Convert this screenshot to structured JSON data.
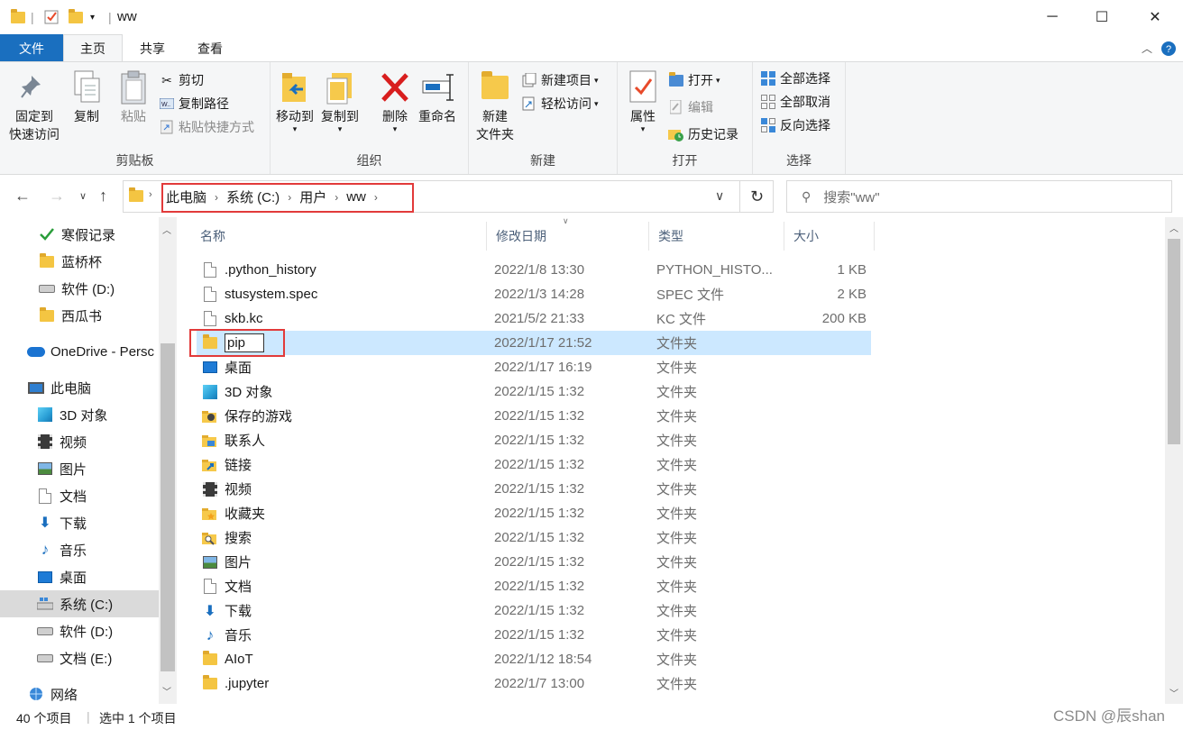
{
  "window": {
    "title": "ww",
    "controls": {
      "minimize": "─",
      "maximize": "☐",
      "close": "✕"
    }
  },
  "ribbon_tabs": [
    "文件",
    "主页",
    "共享",
    "查看"
  ],
  "ribbon": {
    "clipboard": {
      "label": "剪贴板",
      "pin_line1": "固定到",
      "pin_line2": "快速访问",
      "copy": "复制",
      "paste": "粘贴",
      "cut": "剪切",
      "copy_path": "复制路径",
      "paste_shortcut": "粘贴快捷方式"
    },
    "organize": {
      "label": "组织",
      "move_to": "移动到",
      "copy_to": "复制到",
      "delete": "删除",
      "rename": "重命名"
    },
    "new": {
      "label": "新建",
      "new_folder_line1": "新建",
      "new_folder_line2": "文件夹",
      "new_item": "新建项目",
      "easy_access": "轻松访问"
    },
    "open": {
      "label": "打开",
      "properties": "属性",
      "open": "打开",
      "edit": "编辑",
      "history": "历史记录"
    },
    "select": {
      "label": "选择",
      "select_all": "全部选择",
      "select_none": "全部取消",
      "invert": "反向选择"
    }
  },
  "address": {
    "crumbs": [
      "此电脑",
      "系统 (C:)",
      "用户",
      "ww"
    ],
    "search_placeholder": "搜索\"ww\""
  },
  "sidebar": {
    "items": [
      {
        "label": "寒假记录",
        "icon": "pin-check-icon"
      },
      {
        "label": "蓝桥杯",
        "icon": "folder-icon"
      },
      {
        "label": "软件 (D:)",
        "icon": "drive-icon"
      },
      {
        "label": "西瓜书",
        "icon": "folder-icon"
      },
      {
        "label": "OneDrive - Persc",
        "icon": "cloud-icon"
      },
      {
        "label": "此电脑",
        "icon": "computer-icon"
      },
      {
        "label": "3D 对象",
        "icon": "cube-icon"
      },
      {
        "label": "视频",
        "icon": "film-icon"
      },
      {
        "label": "图片",
        "icon": "picture-icon"
      },
      {
        "label": "文档",
        "icon": "document-icon"
      },
      {
        "label": "下载",
        "icon": "download-icon"
      },
      {
        "label": "音乐",
        "icon": "music-icon"
      },
      {
        "label": "桌面",
        "icon": "desktop-icon"
      },
      {
        "label": "系统 (C:)",
        "icon": "windows-drive-icon"
      },
      {
        "label": "软件 (D:)",
        "icon": "drive-icon"
      },
      {
        "label": "文档 (E:)",
        "icon": "drive-icon"
      },
      {
        "label": "网络",
        "icon": "network-icon"
      }
    ]
  },
  "columns": {
    "name": "名称",
    "date": "修改日期",
    "type": "类型",
    "size": "大小"
  },
  "files": [
    {
      "name": ".python_history",
      "date": "2022/1/8 13:30",
      "type": "PYTHON_HISTO...",
      "size": "1 KB",
      "icon": "file-icon"
    },
    {
      "name": "stusystem.spec",
      "date": "2022/1/3 14:28",
      "type": "SPEC 文件",
      "size": "2 KB",
      "icon": "file-icon"
    },
    {
      "name": "skb.kc",
      "date": "2021/5/2 21:33",
      "type": "KC 文件",
      "size": "200 KB",
      "icon": "file-icon"
    },
    {
      "name": "pip",
      "date": "2022/1/17 21:52",
      "type": "文件夹",
      "size": "",
      "icon": "folder-icon"
    },
    {
      "name": "桌面",
      "date": "2022/1/17 16:19",
      "type": "文件夹",
      "size": "",
      "icon": "desktop-icon"
    },
    {
      "name": "3D 对象",
      "date": "2022/1/15 1:32",
      "type": "文件夹",
      "size": "",
      "icon": "cube-icon"
    },
    {
      "name": "保存的游戏",
      "date": "2022/1/15 1:32",
      "type": "文件夹",
      "size": "",
      "icon": "games-folder-icon"
    },
    {
      "name": "联系人",
      "date": "2022/1/15 1:32",
      "type": "文件夹",
      "size": "",
      "icon": "contacts-folder-icon"
    },
    {
      "name": "链接",
      "date": "2022/1/15 1:32",
      "type": "文件夹",
      "size": "",
      "icon": "links-folder-icon"
    },
    {
      "name": "视频",
      "date": "2022/1/15 1:32",
      "type": "文件夹",
      "size": "",
      "icon": "film-icon"
    },
    {
      "name": "收藏夹",
      "date": "2022/1/15 1:32",
      "type": "文件夹",
      "size": "",
      "icon": "favorites-folder-icon"
    },
    {
      "name": "搜索",
      "date": "2022/1/15 1:32",
      "type": "文件夹",
      "size": "",
      "icon": "search-folder-icon"
    },
    {
      "name": "图片",
      "date": "2022/1/15 1:32",
      "type": "文件夹",
      "size": "",
      "icon": "picture-icon"
    },
    {
      "name": "文档",
      "date": "2022/1/15 1:32",
      "type": "文件夹",
      "size": "",
      "icon": "document-icon"
    },
    {
      "name": "下载",
      "date": "2022/1/15 1:32",
      "type": "文件夹",
      "size": "",
      "icon": "download-icon"
    },
    {
      "name": "音乐",
      "date": "2022/1/15 1:32",
      "type": "文件夹",
      "size": "",
      "icon": "music-icon"
    },
    {
      "name": "AIoT",
      "date": "2022/1/12 18:54",
      "type": "文件夹",
      "size": "",
      "icon": "folder-icon"
    },
    {
      "name": ".jupyter",
      "date": "2022/1/7 13:00",
      "type": "文件夹",
      "size": "",
      "icon": "folder-icon"
    }
  ],
  "status": {
    "item_count": "40 个项目",
    "selected": "选中 1 个项目"
  },
  "watermark": "CSDN @辰shan",
  "colors": {
    "accent": "#1a6fbf",
    "selection": "#cce8ff",
    "highlight_box": "#e23a3a"
  }
}
